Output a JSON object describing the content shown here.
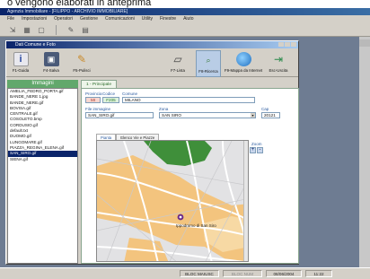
{
  "caption": "o vengono elaborati in anteprima",
  "app_title": "Agenzia Immobiliare - [FILIPPO - ARCHIVIO IMMOBILIARE]",
  "outer_menu": [
    "File",
    "Impostazioni",
    "Operatori",
    "Gestione",
    "Comunicazioni",
    "Utility",
    "Finestre",
    "Aiuto"
  ],
  "window_title": "Dati Comune e Foto",
  "toolbar": {
    "guida": "F1-Guida",
    "salva": "F4-Salva",
    "pulisci": "F5-Pulisci",
    "lista": "F7-Lista",
    "ricerca": "F8-Ricerca",
    "mappa": "F9-Mappa da Internet",
    "esci": "Esc-Uscita"
  },
  "left_panel": {
    "title": "Immagini",
    "files": [
      "AMELIA_FEDRO_PORTA.gif",
      "BANDE_NERE 1.jpg",
      "BANDE_NERE.gif",
      "BOVISA.gif",
      "CENTRALE.gif",
      "COSOLETO.bmp",
      "CORDUSIO.gif",
      "default.txt",
      "DUOMO.gif",
      "LUNGOMARE.gif",
      "PIAZZA_REGINA_ELENA.gif",
      "SAN_SIRO.gif",
      "SIENA.gif"
    ],
    "selected_index": 11
  },
  "main_tab": "1 - Principale",
  "form": {
    "provincia_label": "Provincia",
    "provincia_value": "MI",
    "codice_label": "Codice",
    "codice_value": "F205",
    "comune_label": "Comune",
    "comune_value": "MILANO",
    "file_label": "File immagine",
    "file_value": "SAN_SIRO.gif",
    "zona_label": "Zona",
    "zona_value": "SAN SIRO",
    "cap_label": "Cap",
    "cap_value": "20121"
  },
  "subtabs": [
    "Pianta",
    "Elenco Vie e Piazze"
  ],
  "zoom": {
    "label": "Zoom",
    "plus": "+",
    "minus": "-"
  },
  "map": {
    "poi_label": "Ippodromo di San Siro"
  },
  "status": {
    "caps": "BLOC MAIUSC",
    "num": "BLOC NUM",
    "date": "08/06/2004",
    "time": "11:22"
  },
  "colors": {
    "accent": "#0a246a",
    "list_header": "#62a86c",
    "map_road": "#f3c47e",
    "map_green": "#3f8f3a"
  }
}
